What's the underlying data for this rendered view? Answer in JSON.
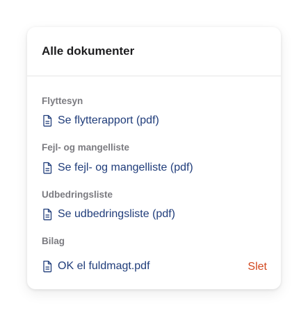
{
  "card": {
    "title": "Alle dokumenter"
  },
  "sections": [
    {
      "label": "Flyttesyn",
      "link": "Se flytterapport (pdf)"
    },
    {
      "label": "Fejl- og mangelliste",
      "link": "Se fejl- og mangelliste (pdf)"
    },
    {
      "label": "Udbedringsliste",
      "link": "Se udbedringsliste (pdf)"
    },
    {
      "label": "Bilag",
      "link": "OK el fuldmagt.pdf",
      "delete_label": "Slet"
    }
  ],
  "colors": {
    "link": "#1f3c7a",
    "label": "#7b7b80",
    "delete": "#d2461d"
  },
  "icons": {
    "document": "document-icon"
  }
}
